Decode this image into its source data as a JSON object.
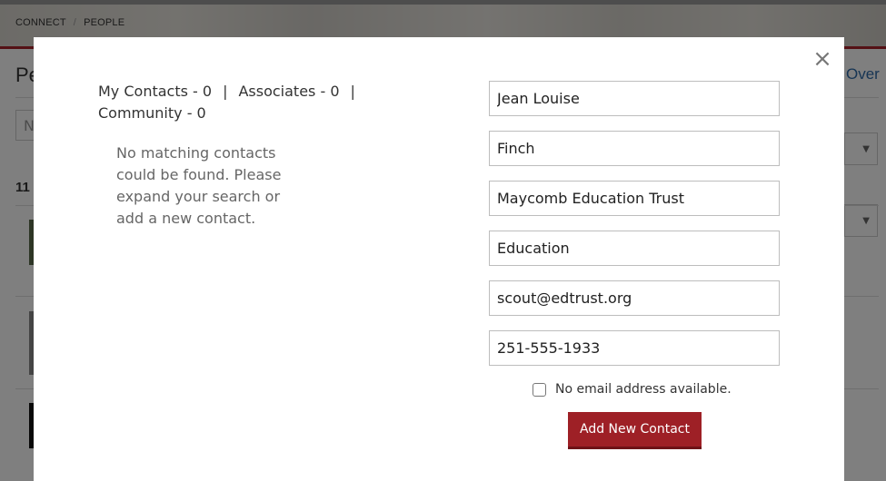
{
  "background": {
    "breadcrumb": [
      "CONNECT",
      "PEOPLE"
    ],
    "breadcrumb_sep": "/",
    "title_partial": "Pe",
    "link_partial": "Over",
    "search_partial": "N",
    "count_partial": "11"
  },
  "modal": {
    "close_label": "×",
    "tabs": [
      {
        "label": "My Contacts - 0"
      },
      {
        "label": "Associates - 0"
      },
      {
        "label": "Community - 0"
      }
    ],
    "tab_separator": "|",
    "empty_message": "No matching contacts could be found. Please expand your search or add a new contact.",
    "fields": {
      "first_name": "Jean Louise",
      "last_name": "Finch",
      "organization": "Maycomb Education Trust",
      "sector": "Education",
      "email": "scout@edtrust.org",
      "phone": "251-555-1933"
    },
    "no_email_label": "No email address available.",
    "no_email_checked": false,
    "submit_label": "Add New Contact"
  },
  "colors": {
    "accent": "#9e2026",
    "link": "#2f6aa8"
  }
}
